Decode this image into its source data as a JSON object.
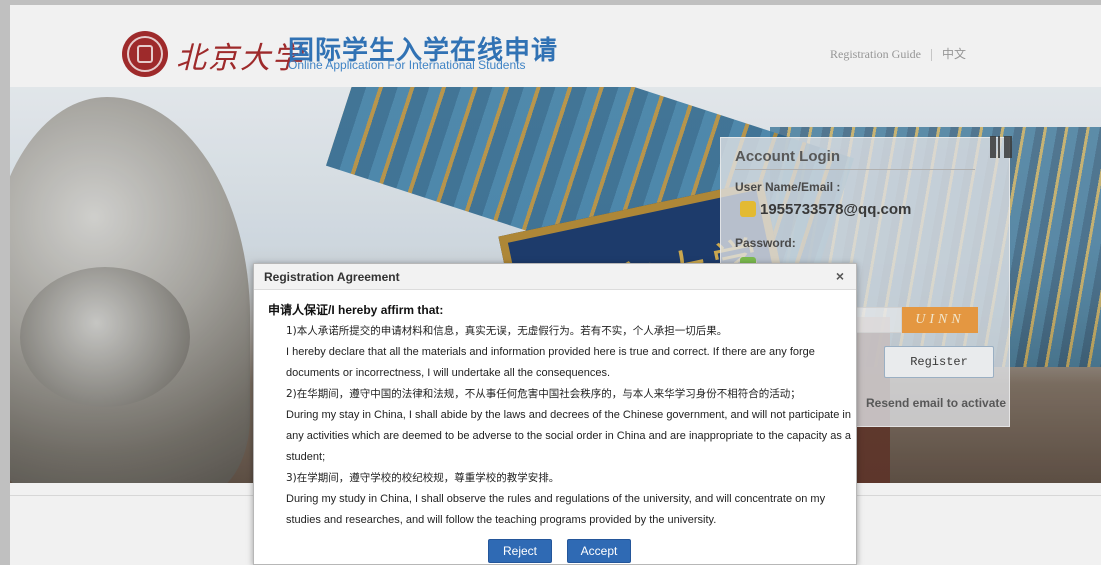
{
  "header": {
    "logo_calligraphy": "北京大学",
    "cn_title": "国际学生入学在线申请",
    "en_title": "Online Application For International Students",
    "nav": {
      "guide": "Registration Guide",
      "language": "中文"
    }
  },
  "login": {
    "title": "Account Login",
    "username_label": "User Name/Email :",
    "username_value": "1955733578@qq.com",
    "password_label": "Password:",
    "captcha_text": "UINN",
    "register_label": "Register",
    "resend_label": "Resend email to activate"
  },
  "icons": {
    "user": "user-icon",
    "password": "lock-icon",
    "qr": "qr-code-icon",
    "close": "close-icon"
  },
  "dialog": {
    "title": "Registration Agreement",
    "close_glyph": "×",
    "heading": "申请人保证/I hereby affirm that:",
    "items": [
      {
        "cn": "1)本人承诺所提交的申请材料和信息，真实无误，无虚假行为。若有不实，个人承担一切后果。",
        "en": "I hereby declare that all the materials and information provided here is true and correct. If there are any forge documents or incorrectness, I will undertake all the consequences."
      },
      {
        "cn": "2)在华期间，遵守中国的法律和法规，不从事任何危害中国社会秩序的，与本人来华学习身份不相符合的活动；",
        "en": "During my stay in China, I shall abide by the laws and decrees of the Chinese government, and will not participate in any activities which are deemed to be adverse to the social order in China and are inappropriate to the capacity as a student;"
      },
      {
        "cn": "3)在学期间，遵守学校的校纪校规，尊重学校的教学安排。",
        "en": "During my study in China, I shall observe the rules and regulations of the university, and will concentrate on my studies and researches, and will follow the teaching programs provided by the university."
      }
    ],
    "reject_label": "Reject",
    "accept_label": "Accept"
  },
  "colors": {
    "brand_red": "#a32223",
    "brand_blue": "#2a72bc",
    "button_blue": "#2f6ab4",
    "captcha_orange": "#f19b3b"
  }
}
